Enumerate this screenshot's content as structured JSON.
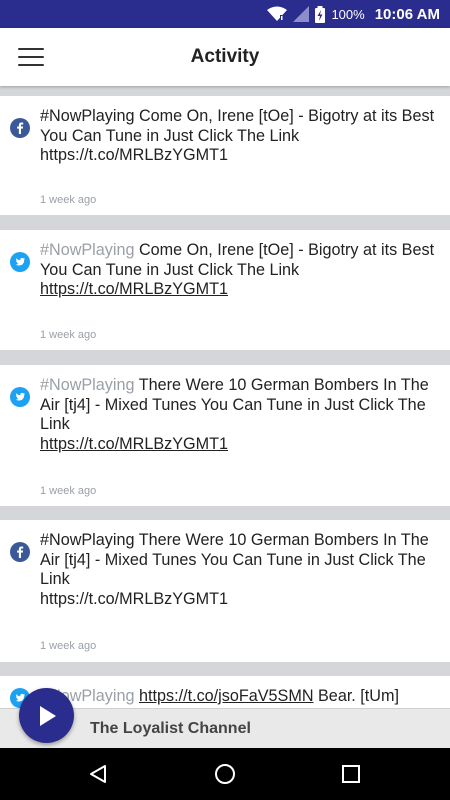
{
  "status_bar": {
    "battery": "100%",
    "time": "10:06 AM"
  },
  "app_bar": {
    "title": "Activity"
  },
  "feed": [
    {
      "source": "facebook",
      "hashtag": "#NowPlaying",
      "text": " Come On, Irene  [tOe] - Bigotry at its Best You Can  Tune in Just Click The Link",
      "link": "https://t.co/MRLBzYGMT1",
      "time": "1 week ago"
    },
    {
      "source": "twitter",
      "hashtag": "#NowPlaying",
      "text": " Come On, Irene  [tOe] - Bigotry at its Best You Can  Tune in Just Click The Link",
      "link": "https://t.co/MRLBzYGMT1",
      "time": "1 week ago"
    },
    {
      "source": "twitter",
      "hashtag": "#NowPlaying",
      "text": " There Were 10 German Bombers In The Air [tj4] - Mixed Tunes You Can  Tune in Just Click The Link",
      "link": "https://t.co/MRLBzYGMT1",
      "time": "1 week ago"
    },
    {
      "source": "facebook",
      "hashtag": "#NowPlaying",
      "text": " There Were 10 German Bombers In The Air [tj4] - Mixed Tunes You Can  Tune in Just Click The Link",
      "link": "https://t.co/MRLBzYGMT1",
      "time": "1 week ago"
    },
    {
      "source": "twitter",
      "hashtag": "#NowPlaying",
      "link": "https://t.co/jsoFaV5SMN",
      "text": " Bear. [tUm]"
    }
  ],
  "player": {
    "station": "The Loyalist Channel"
  },
  "colors": {
    "primary": "#2b2d8e",
    "facebook": "#3b5998",
    "twitter": "#1da1f2",
    "muted": "#9aa0a6"
  }
}
